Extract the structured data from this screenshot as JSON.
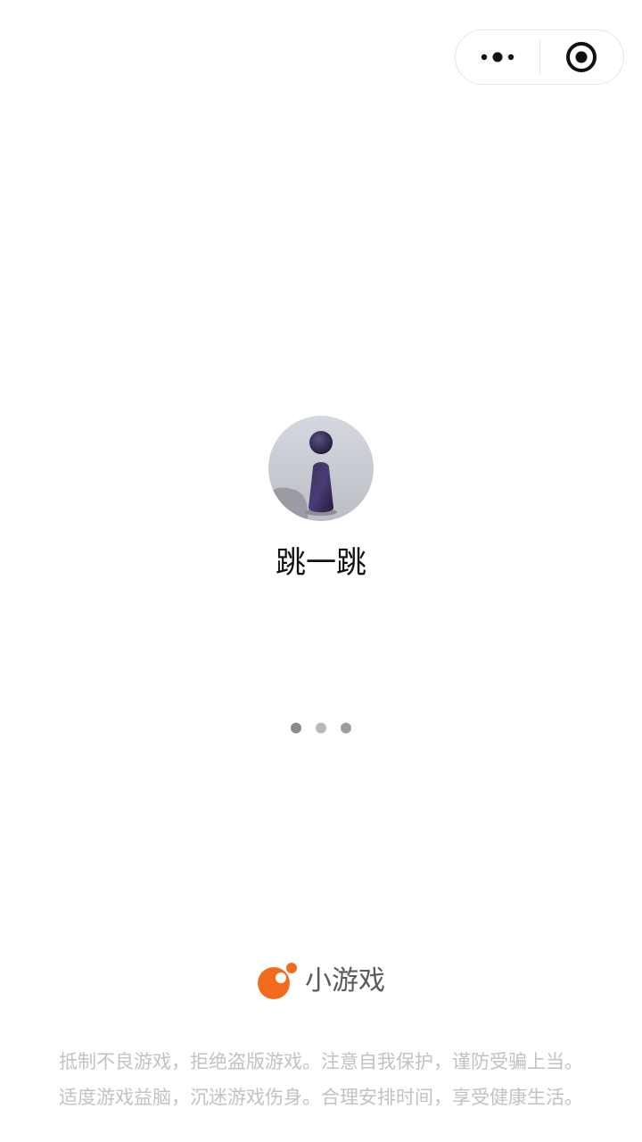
{
  "capsule": {
    "more_icon": "more-dots-icon",
    "close_icon": "target-close-icon"
  },
  "game": {
    "icon": "jump-piece-avatar",
    "title": "跳一跳"
  },
  "loading": {
    "dot_colors": [
      "#8a8a8a",
      "#b8b8b8",
      "#9e9e9e"
    ]
  },
  "brand": {
    "logo_icon": "mini-game-logo-icon",
    "label": "小游戏",
    "accent": "#f26b1d"
  },
  "notice": {
    "line1": "抵制不良游戏，拒绝盗版游戏。注意自我保护，谨防受骗上当。",
    "line2": "适度游戏益脑，沉迷游戏伤身。合理安排时间，享受健康生活。"
  }
}
